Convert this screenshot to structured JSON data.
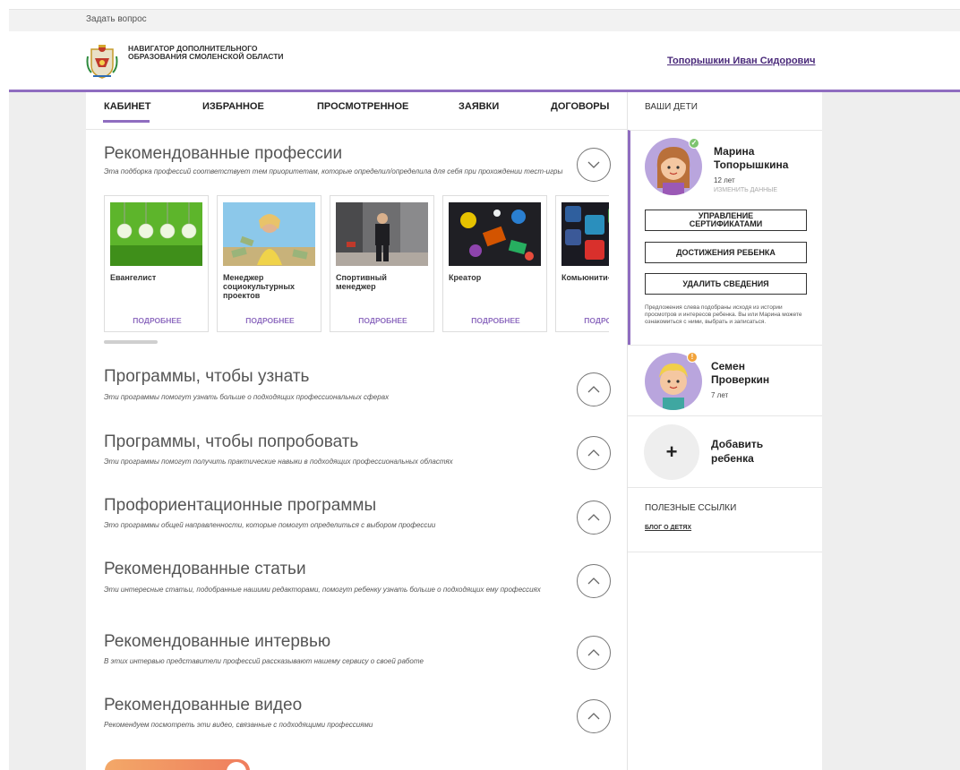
{
  "topbar": {
    "ask_label": "Задать вопрос"
  },
  "header": {
    "brand": "НАВИГАТОР ДОПОЛНИТЕЛЬНОГО ОБРАЗОВАНИЯ СМОЛЕНСКОЙ ОБЛАСТИ",
    "user_name": "Топорышкин Иван Сидорович"
  },
  "tabs": [
    {
      "label": "КАБИНЕТ",
      "active": true
    },
    {
      "label": "ИЗБРАННОЕ"
    },
    {
      "label": "ПРОСМОТРЕННОЕ"
    },
    {
      "label": "ЗАЯВКИ"
    },
    {
      "label": "ДОГОВОРЫ"
    }
  ],
  "professions": {
    "title": "Рекомендованные профессии",
    "desc": "Эта подборка профессий соответствует тем приоритетам, которые определил/определила для себя при прохождении тест-игры",
    "more_label": "ПОДРОБНЕЕ",
    "cards": [
      {
        "name": "Евангелист"
      },
      {
        "name": "Менеджер социокультурных проектов"
      },
      {
        "name": "Спортивный менеджер"
      },
      {
        "name": "Креатор"
      },
      {
        "name": "Комьюнити-менеджер"
      }
    ]
  },
  "sections": [
    {
      "title": "Программы, чтобы узнать",
      "desc": "Эти программы помогут узнать больше о подходящих профессиональных сферах"
    },
    {
      "title": "Программы, чтобы попробовать",
      "desc": "Эти программы помогут получить практические навыки в подходящих профессиональных областях"
    },
    {
      "title": "Профориентационные программы",
      "desc": "Это программы общей направленности, которые помогут определиться с выбором профессии"
    },
    {
      "title": "Рекомендованные статьи",
      "desc": "Эти интересные статьи, подобранные нашими редакторами, помогут ребенку узнать больше о подходящих ему профессиях"
    },
    {
      "title": "Рекомендованные интервью",
      "desc": "В этих интервью представители профессий рассказывают нашему сервису о своей работе"
    },
    {
      "title": "Рекомендованные видео",
      "desc": "Рекомендуем посмотреть эти видео, связанные с подходящими профессиями"
    }
  ],
  "sidebar": {
    "header": "ВАШИ ДЕТИ",
    "child1": {
      "name_line1": "Марина",
      "name_line2": "Топорышкина",
      "age": "12 лет",
      "edit_label": "ИЗМЕНИТЬ ДАННЫЕ",
      "btn_certs_line1": "УПРАВЛЕНИЕ",
      "btn_certs_line2": "СЕРТИФИКАТАМИ",
      "btn_achievements": "ДОСТИЖЕНИЯ РЕБЕНКА",
      "btn_delete": "УДАЛИТЬ СВЕДЕНИЯ",
      "note": "Предложения слева подобраны исходя из истории просмотров и интересов ребенка. Вы или Марина можете ознакомиться с ними, выбрать и записаться."
    },
    "child2": {
      "name_line1": "Семен",
      "name_line2": "Проверкин",
      "age": "7 лет"
    },
    "add_child_line1": "Добавить",
    "add_child_line2": "ребенка",
    "useful_links_header": "ПОЛЕЗНЫЕ ССЫЛКИ",
    "useful_link": "БЛОГ О ДЕТЯХ"
  },
  "colors": {
    "accent": "#8f6dc0",
    "link": "#4a2a7a"
  }
}
